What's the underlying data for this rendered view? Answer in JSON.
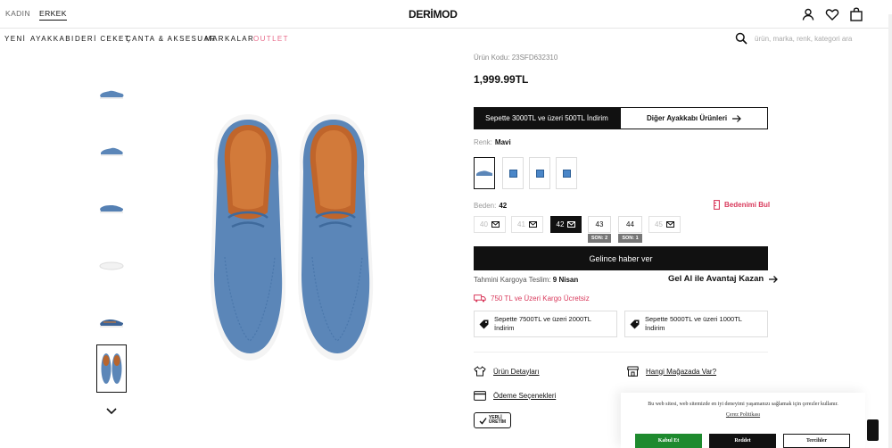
{
  "header": {
    "tabs": [
      "KADIN",
      "ERKEK"
    ],
    "logo": "DERİMOD"
  },
  "nav": {
    "items": [
      "YENİ",
      "AYAKKABI",
      "DERİ CEKET",
      "ÇANTA & AKSESUAR",
      "MARKALAR",
      "OUTLET"
    ],
    "search_placeholder": "ürün, marka, renk, kategori ara"
  },
  "product": {
    "code": "Ürün Kodu: 23SFD632310",
    "price": "1,999.99TL",
    "promo_dark": "Sepette 3000TL ve üzeri 500TL İndirim",
    "promo_outline": "Diğer Ayakkabı Ürünleri",
    "color_label": "Renk:",
    "color_value": "Mavi",
    "size_label": "Beden:",
    "size_value": "42",
    "size_finder": "Bedenimi Bul",
    "sizes": [
      {
        "label": "40",
        "state": "disabled"
      },
      {
        "label": "41",
        "state": "disabled"
      },
      {
        "label": "42",
        "state": "selected"
      },
      {
        "label": "43",
        "state": "available",
        "stock": "SON: 2"
      },
      {
        "label": "44",
        "state": "available",
        "stock": "SON: 1"
      },
      {
        "label": "45",
        "state": "disabled"
      }
    ],
    "notify_button": "Gelince haber ver",
    "delivery_label": "Tahmini Kargoya Teslim:",
    "delivery_date": "9 Nisan",
    "advantage": "Gel Al ile Avantaj Kazan",
    "free_shipping": "750 TL ve Üzeri Kargo Ücretsiz",
    "coupons": [
      "Sepette 7500TL ve üzeri 2000TL İndirim",
      "Sepette 5000TL ve üzeri 1000TL İndirim"
    ],
    "details_link": "Ürün Detayları",
    "store_link": "Hangi Mağazada Var?",
    "payment_link": "Ödeme Seçenekleri",
    "yerli_line1": "YERLİ",
    "yerli_line2": "ÜRETİM"
  },
  "cookie": {
    "text": "Bu web sitesi, web sitemizde en iyi deneyimi yaşamanızı sağlamak için çerezler kullanır.",
    "policy_link": "Çerez Politikası",
    "accept": "Kabul Et",
    "reject": "Reddet",
    "preferences": "Tercihler"
  },
  "colors": {
    "accent_pink": "#d93a5c",
    "outlet_pink": "#e86a8a",
    "accept_green": "#1e8a2e",
    "shoe_blue": "#5b86b8"
  }
}
